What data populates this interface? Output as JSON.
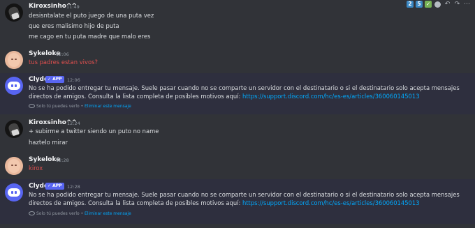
{
  "toolbar": {
    "reactions": [
      "2",
      "5",
      "✓"
    ],
    "icons": [
      "reaction-icon",
      "reply-icon",
      "forward-icon",
      "more-icon"
    ]
  },
  "messages": [
    {
      "author": "Kiroxsinho^^",
      "time": "11:49",
      "lines": [
        "desisntalate el puto juego de una puta vez",
        "que eres malisimo hijo de puta",
        "me cago en tu puta madre que malo eres"
      ]
    },
    {
      "author": "Sykeloke",
      "time": "12:06",
      "lines": [
        "tus padres estan vivos?"
      ]
    },
    {
      "author": "Clyde",
      "badge": "✓ APP",
      "time": "12:06",
      "text": "No se ha podido entregar tu mensaje. Suele pasar cuando no se comparte un servidor con el destinatario o si el destinatario solo acepta mensajes directos de amigos. Consulta la lista completa de posibles motivos aquí:",
      "link": "https://support.discord.com/hc/es-es/articles/360060145013",
      "note": "Solo tú puedes verlo",
      "note_sep": " • ",
      "note_action": "Eliminar este mensaje"
    },
    {
      "author": "Kiroxsinho^^",
      "time": "12:24",
      "lines": [
        "+ subirme a twitter siendo un puto no name",
        "haztelo mirar"
      ]
    },
    {
      "author": "Sykeloke",
      "time": "12:28",
      "lines": [
        "kirox"
      ]
    },
    {
      "author": "Clyde",
      "badge": "✓ APP",
      "time": "12:28",
      "text": "No se ha podido entregar tu mensaje. Suele pasar cuando no se comparte un servidor con el destinatario o si el destinatario solo acepta mensajes directos de amigos. Consulta la lista completa de posibles motivos aquí:",
      "link": "https://support.discord.com/hc/es-es/articles/360060145013",
      "note": "Solo tú puedes verlo",
      "note_sep": " • ",
      "note_action": "Eliminar este mensaje"
    }
  ]
}
